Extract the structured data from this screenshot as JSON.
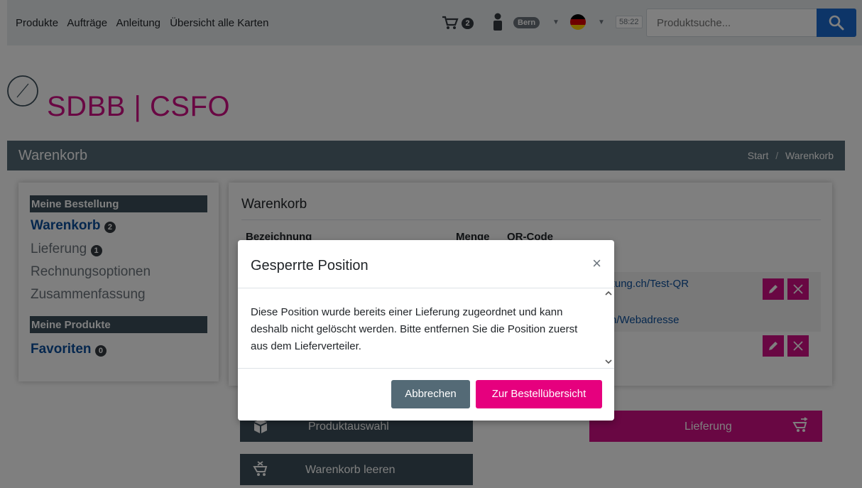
{
  "nav": {
    "links": [
      "Produkte",
      "Aufträge",
      "Anleitung",
      "Übersicht alle Karten"
    ],
    "cart_count": "2",
    "region": "Bern",
    "timer": "58:22",
    "search_placeholder": "Produktsuche..."
  },
  "logo": {
    "text": "SDBB | CSFO"
  },
  "page_header": {
    "title": "Warenkorb",
    "breadcrumb": [
      "Start",
      "/",
      "Warenkorb"
    ]
  },
  "sidebar": {
    "section1_title": "Meine Bestellung",
    "items": [
      {
        "label": "Warenkorb",
        "count": "2"
      },
      {
        "label": "Lieferung",
        "count": "1"
      },
      {
        "label": "Rechnungsoptionen"
      },
      {
        "label": "Zusammenfassung"
      }
    ],
    "section2_title": "Meine Produkte",
    "favorites": {
      "label": "Favoriten",
      "count": "0"
    }
  },
  "cart": {
    "title": "Warenkorb",
    "columns": [
      "Bezeichnung",
      "Menge",
      "QR-Code"
    ],
    "rows": [
      {
        "qr_link": "eratung.ch/Test-QR",
        "web_link": "g.ch/Webadresse"
      }
    ]
  },
  "actions": {
    "product_selection": "Produktauswahl",
    "delivery": "Lieferung",
    "empty_cart": "Warenkorb leeren"
  },
  "modal": {
    "title": "Gesperrte Position",
    "close_symbol": "×",
    "body": "Diese Position wurde bereits einer Lieferung zugeordnet und kann deshalb nicht gelöscht werden. Bitte entfernen Sie die Position zuerst aus dem Lieferverteiler.",
    "cancel_label": "Abbrechen",
    "confirm_label": "Zur Bestellübersicht"
  },
  "colors": {
    "accent": "#d30f86",
    "dark": "#3c4f5a",
    "header": "#546a76",
    "link": "#0b4f9c",
    "search": "#1a6ad1"
  }
}
